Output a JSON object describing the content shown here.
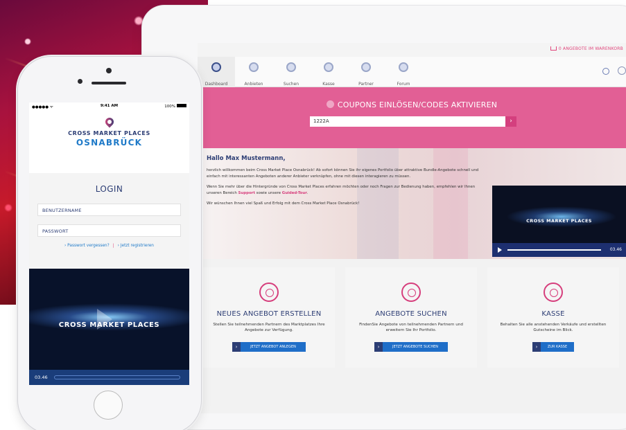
{
  "colors": {
    "brand_pink": "#e25f95",
    "brand_navy": "#2c3d74",
    "button_blue": "#1f6ec8"
  },
  "tablet": {
    "cart_link": "0 ANGEBOTE IM WARENKORB",
    "nav": [
      {
        "label": "Dashboard",
        "icon": "dashboard-icon",
        "active": true
      },
      {
        "label": "Anbieten",
        "icon": "offer-icon"
      },
      {
        "label": "Suchen",
        "icon": "search-icon"
      },
      {
        "label": "Kasse",
        "icon": "register-icon"
      },
      {
        "label": "Partner",
        "icon": "partner-icon"
      },
      {
        "label": "Forum",
        "icon": "forum-icon"
      }
    ],
    "coupons": {
      "title": "COUPONS EINLÖSEN/CODES AKTIVIEREN",
      "input_value": "1222A",
      "go": "›"
    },
    "welcome": {
      "greeting": "Hallo Max Mustermann,",
      "para1": "herzlich willkommen beim Cross Market Place Osnabrück! Ab sofort können Sie ihr eigenes Portfolio über attraktive Bundle-Angebote schnell und einfach mit interessanten Angeboten anderer Anbieter verknüpfen, ohne mit diesen interagieren zu müssen.",
      "para2_a": "Wenn Sie mehr über die Hintergründe von Cross Market Places erfahren möchten oder noch Fragen zur Bedienung haben, empfehlen wir Ihnen unseren Bereich ",
      "para2_link1": "Support",
      "para2_b": " sowie unsere ",
      "para2_link2": "Guided-Tour",
      "para2_c": ".",
      "para3": "Wir wünschen Ihnen viel Spaß und Erfolg mit dem Cross Market Place Osnabrück!"
    },
    "video": {
      "title": "CROSS MARKET PLACES",
      "time": "03.46"
    },
    "cards": [
      {
        "icon": "percent-icon",
        "title": "NEUES ANGEBOT ERSTELLEN",
        "desc": "Stellen Sie teilnehmenden Partnern des Marktplatzes Ihre Angebote zur Verfügung.",
        "button": "JETZT ANGEBOT ANLEGEN"
      },
      {
        "icon": "magnifier-icon",
        "title": "ANGEBOTE SUCHEN",
        "desc": "FindenSie Angebote von teilnehmenden Partnern und erweitern Sie Ihr Portfolio.",
        "button": "JETZT ANGEBOTE SUCHEN"
      },
      {
        "icon": "cash-register-icon",
        "title": "KASSE",
        "desc": "Behalten Sie alle anstehenden Verkäufe und erstellten Gutscheine im Blick.",
        "button": "ZUR KASSE"
      }
    ]
  },
  "phone": {
    "status": {
      "carrier": "●●●●● ᯤ",
      "time": "9:41 AM",
      "battery": "100%"
    },
    "brand_line1": "CROSS MARKET PLACES",
    "brand_line2": "OSNABRÜCK",
    "login": {
      "title": "LOGIN",
      "username_placeholder": "BENUTZERNAME",
      "password_placeholder": "PASSWORT",
      "forgot_link": "› Passwort vergessen?",
      "separator": "|",
      "register_link": "› Jetzt registrieren"
    },
    "video": {
      "title": "CROSS MARKET PLACES",
      "time": "03.46"
    }
  }
}
